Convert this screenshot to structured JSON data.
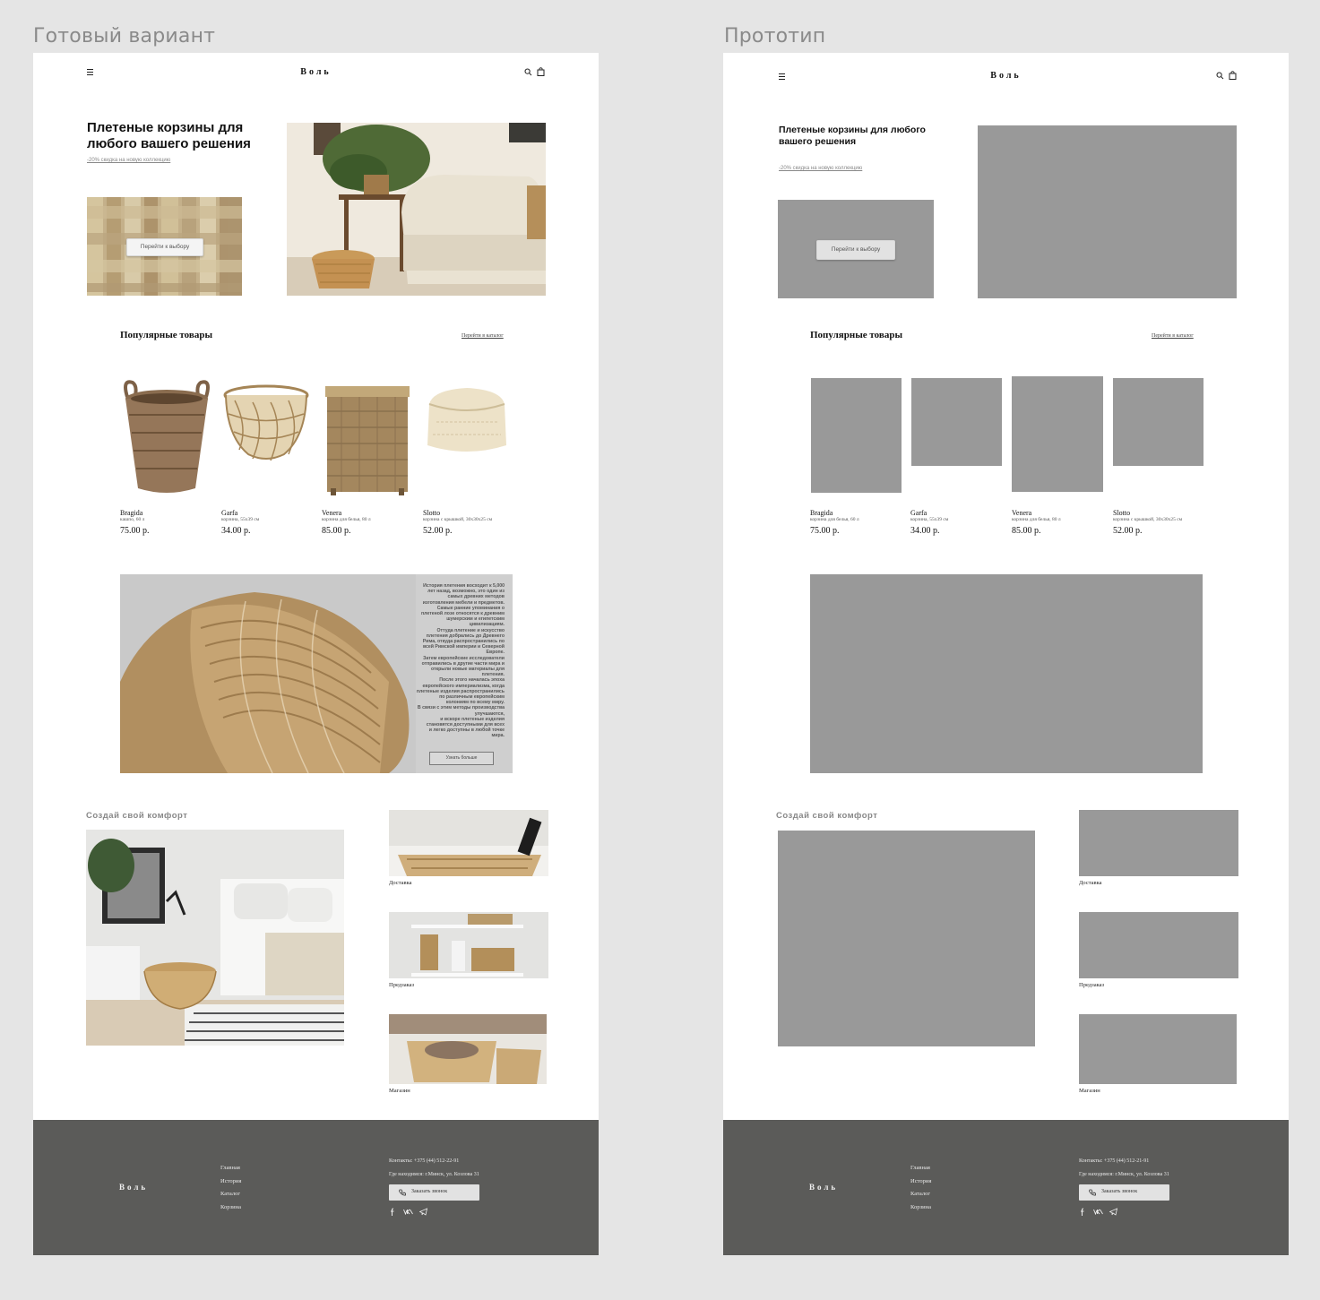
{
  "labels": {
    "final": "Готовый вариант",
    "prototype": "Прототип"
  },
  "header": {
    "logo": "Воль",
    "icons": [
      "menu-icon",
      "search-icon",
      "bag-icon"
    ]
  },
  "hero": {
    "title": "Плетеные корзины для любого вашего решения",
    "discount_link": "-20% скидка на новую коллекцию",
    "cta": "Перейти к выбору"
  },
  "popular": {
    "title": "Популярные товары",
    "catalog_link": "Перейти в каталог",
    "final_products": [
      {
        "name": "Bragida",
        "desc": "кашпо, 60 л",
        "price": "75.00 р."
      },
      {
        "name": "Garfa",
        "desc": "корзина, 55x39 см",
        "price": "34.00 р."
      },
      {
        "name": "Venera",
        "desc": "корзина для белья, 80 л",
        "price": "85.00 р."
      },
      {
        "name": "Slotto",
        "desc": "корзина с крышкой, 30x30x25 см",
        "price": "52.00 р."
      }
    ],
    "proto_products": [
      {
        "name": "Bragida",
        "desc": "корзина для белья, 60 л",
        "price": "75.00 р."
      },
      {
        "name": "Garfa",
        "desc": "корзина, 55x39 см",
        "price": "34.00 р."
      },
      {
        "name": "Venera",
        "desc": "корзина для белья, 80 л",
        "price": "85.00 р."
      },
      {
        "name": "Slotto",
        "desc": "корзина с крышкой, 30x30x25 см",
        "price": "52.00 р."
      }
    ]
  },
  "story": {
    "lines": [
      "История плетения восходит к 5,000",
      "лет назад, возможно, это один из",
      "самых древних методов",
      "изготовления мебели и предметов.",
      "Самые ранние упоминания о",
      "плетеной лозе относятся к древним",
      "шумерским и египетским",
      "цивилизациям.",
      "Оттуда плетение и искусство",
      "плетения добрались до Древнего",
      "Рима, откуда распространились по",
      "всей Римской империи и Северной",
      "Европе.",
      "Затем европейские исследователи",
      "отправились в другие части мира и",
      "открыли новые материалы для",
      "плетения.",
      "После этого началась эпоха",
      "европейского империализма, когда",
      "плетеные изделия распространились",
      "по различным европейским",
      "колониям по всему миру.",
      "В связи с этим методы производства",
      "улучшаются,",
      "и вскоре плетеные изделия",
      "становятся доступными для всех",
      "и легко доступны в любой точке",
      "мира."
    ],
    "more_button": "Узнать больше"
  },
  "comfort": {
    "title": "Создай свой комфорт",
    "services": [
      "Доставка",
      "Предзаказ",
      "Магазин"
    ]
  },
  "footer": {
    "logo": "Воль",
    "nav": [
      "Главная",
      "История",
      "Каталог",
      "Корзина"
    ],
    "contacts": "Контакты: +375 (44) 512-22-91",
    "contacts_proto": "Контакты: +375 (44) 512-21-91",
    "address": "Где находимся: г.Минск, ул. Козлова 31",
    "call_button": "Заказать звонок",
    "social_icons": [
      "facebook-icon",
      "vk-icon",
      "telegram-icon"
    ]
  }
}
